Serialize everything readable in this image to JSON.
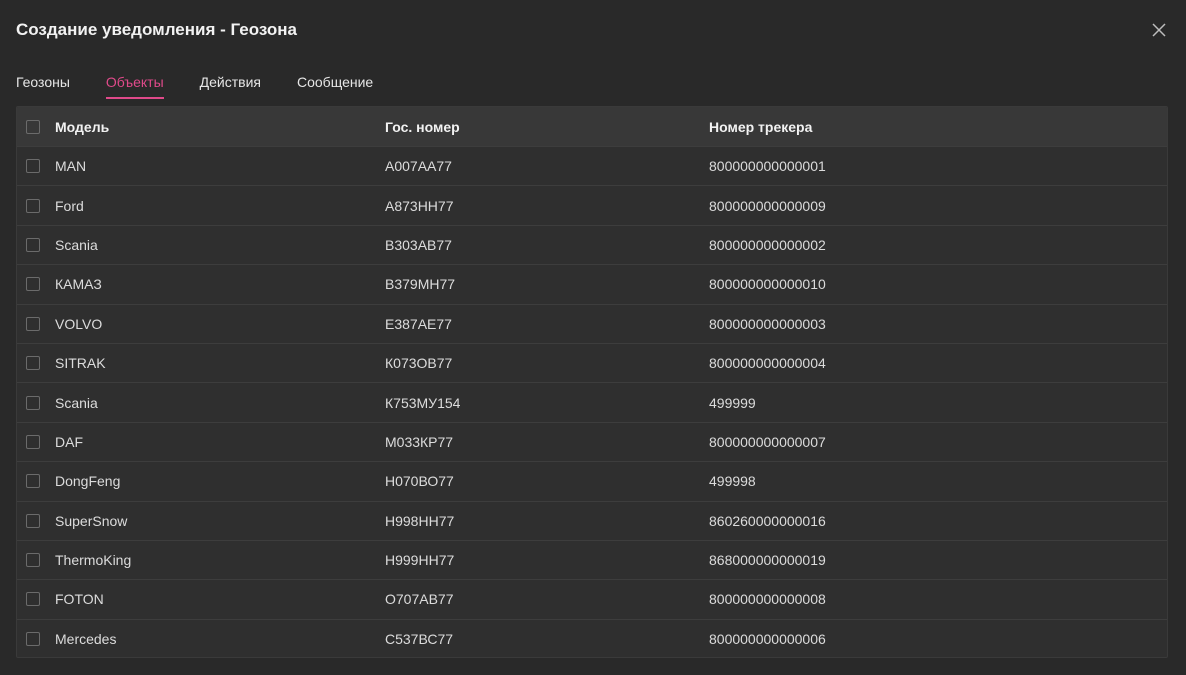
{
  "dialog": {
    "title": "Создание уведомления - Геозона"
  },
  "tabs": [
    {
      "label": "Геозоны"
    },
    {
      "label": "Объекты"
    },
    {
      "label": "Действия"
    },
    {
      "label": "Сообщение"
    }
  ],
  "active_tab": "Объекты",
  "colors": {
    "accent": "#e04a8a",
    "background": "#292929",
    "table_bg": "#2f2f2f",
    "header_bg": "#383838"
  },
  "table": {
    "columns": [
      "Модель",
      "Гос. номер",
      "Номер трекера"
    ],
    "rows": [
      {
        "model": "MAN",
        "plate": "А007АА77",
        "tracker": "800000000000001"
      },
      {
        "model": "Ford",
        "plate": "А873НН77",
        "tracker": "800000000000009"
      },
      {
        "model": "Scania",
        "plate": "В303АВ77",
        "tracker": "800000000000002"
      },
      {
        "model": "КАМАЗ",
        "plate": "В379МН77",
        "tracker": "800000000000010"
      },
      {
        "model": "VOLVO",
        "plate": "Е387АЕ77",
        "tracker": "800000000000003"
      },
      {
        "model": "SITRAK",
        "plate": "К073ОВ77",
        "tracker": "800000000000004"
      },
      {
        "model": "Scania",
        "plate": "К753МУ154",
        "tracker": "499999"
      },
      {
        "model": "DAF",
        "plate": "М033КР77",
        "tracker": "800000000000007"
      },
      {
        "model": "DongFeng",
        "plate": "Н070ВО77",
        "tracker": "499998"
      },
      {
        "model": "SuperSnow",
        "plate": "Н998НН77",
        "tracker": "860260000000016"
      },
      {
        "model": "ThermoKing",
        "plate": "Н999НН77",
        "tracker": "868000000000019"
      },
      {
        "model": "FOTON",
        "plate": "О707АВ77",
        "tracker": "800000000000008"
      },
      {
        "model": "Mercedes",
        "plate": "С537ВС77",
        "tracker": "800000000000006"
      }
    ]
  }
}
